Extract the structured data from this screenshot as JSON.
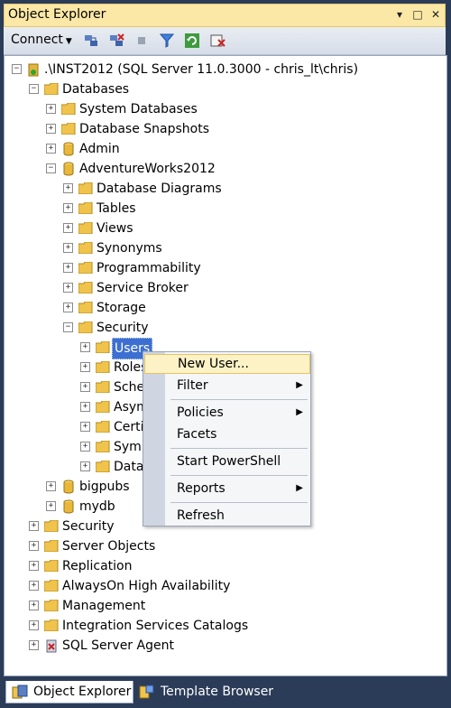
{
  "window": {
    "title": "Object Explorer"
  },
  "toolbar": {
    "connect_label": "Connect"
  },
  "tree": {
    "server": ".\\INST2012 (SQL Server 11.0.3000 - chris_lt\\chris)",
    "databases": "Databases",
    "system_databases": "System Databases",
    "database_snapshots": "Database Snapshots",
    "admin": "Admin",
    "adventureworks": "AdventureWorks2012",
    "database_diagrams": "Database Diagrams",
    "tables": "Tables",
    "views": "Views",
    "synonyms": "Synonyms",
    "programmability": "Programmability",
    "service_broker": "Service Broker",
    "storage": "Storage",
    "security_db": "Security",
    "users": "Users",
    "roles": "Roles",
    "schemas": "Sche",
    "asymmetric": "Asym",
    "certificates": "Certi",
    "symmetric": "Symr",
    "data": "Data",
    "bigpubs": "bigpubs",
    "mydb": "mydb",
    "security_server": "Security",
    "server_objects": "Server Objects",
    "replication": "Replication",
    "alwayson": "AlwaysOn High Availability",
    "management": "Management",
    "integration": "Integration Services Catalogs",
    "sql_agent": "SQL Server Agent"
  },
  "context_menu": {
    "new_user": "New User...",
    "filter": "Filter",
    "policies": "Policies",
    "facets": "Facets",
    "start_powershell": "Start PowerShell",
    "reports": "Reports",
    "refresh": "Refresh"
  },
  "tabs": {
    "object_explorer": "Object Explorer",
    "template_browser": "Template Browser"
  },
  "icons": [
    "pin-icon",
    "maximize-icon",
    "close-icon",
    "connect-icon",
    "disconnect-icon",
    "stop-icon",
    "filter-icon",
    "refresh-icon",
    "summary-icon",
    "folder-icon",
    "database-icon"
  ]
}
